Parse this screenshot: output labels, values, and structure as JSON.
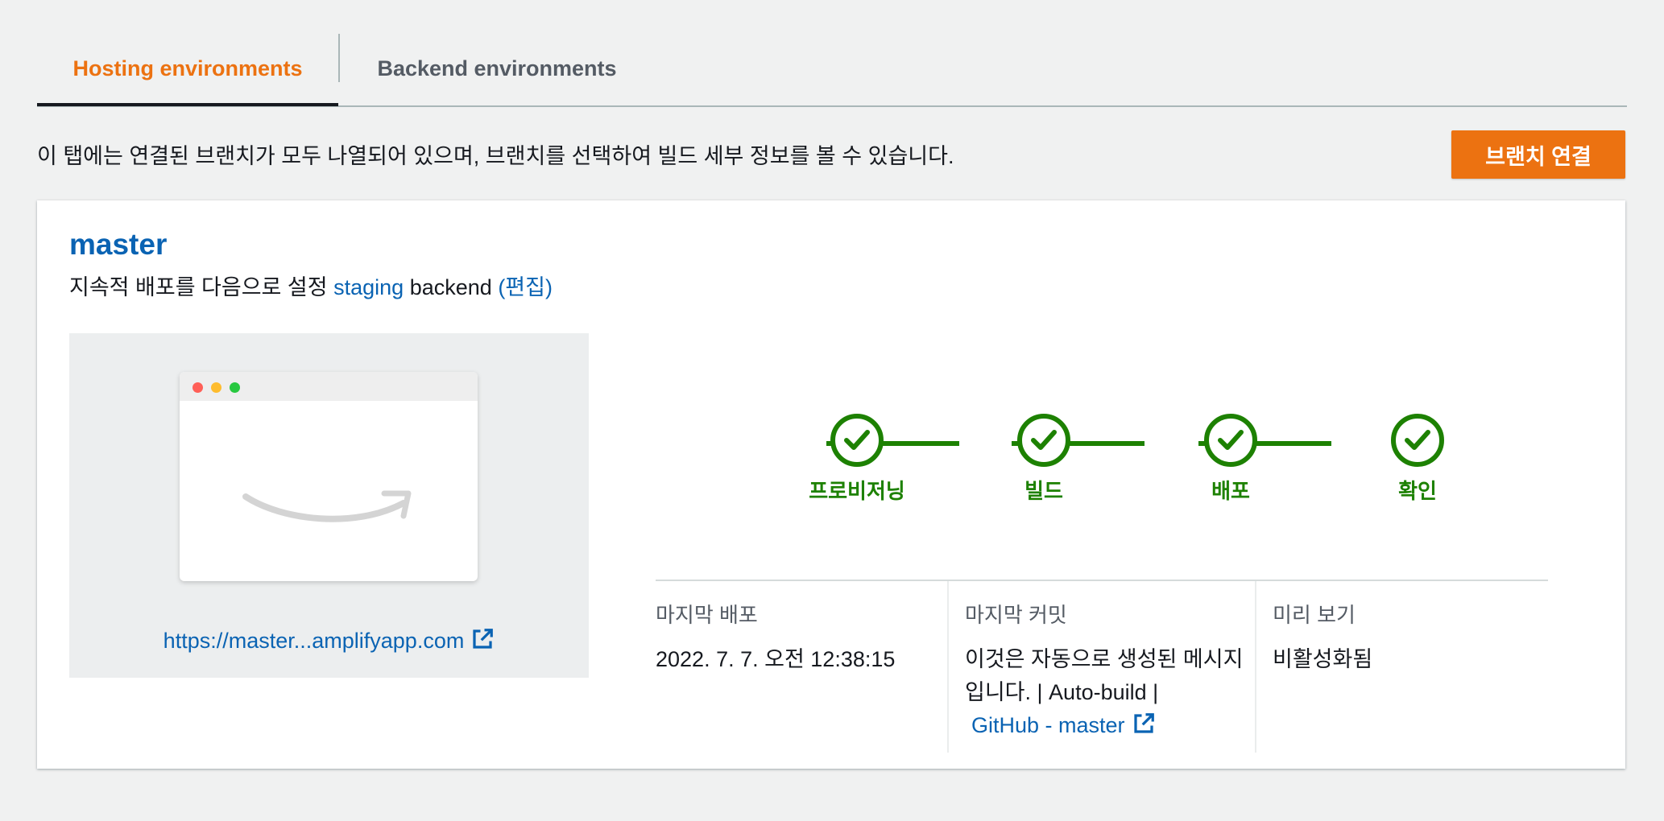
{
  "tabs": [
    {
      "label": "Hosting environments",
      "active": true
    },
    {
      "label": "Backend environments",
      "active": false
    }
  ],
  "description": "이 탭에는 연결된 브랜치가 모두 나열되어 있으며, 브랜치를 선택하여 빌드 세부 정보를 볼 수 있습니다.",
  "connect_branch_button": "브랜치 연결",
  "branch": {
    "name": "master",
    "cd_prefix": "지속적 배포를 다음으로 설정",
    "backend_env": "staging",
    "backend_word": "backend",
    "edit_link": "(편집)"
  },
  "preview": {
    "url": "https://master...amplifyapp.com",
    "url_icon": "external-link-icon"
  },
  "steps": [
    {
      "label": "프로비저닝",
      "status": "success"
    },
    {
      "label": "빌드",
      "status": "success"
    },
    {
      "label": "배포",
      "status": "success"
    },
    {
      "label": "확인",
      "status": "success"
    }
  ],
  "info": {
    "last_deploy_label": "마지막 배포",
    "last_deploy_value": "2022. 7. 7. 오전 12:38:15",
    "last_commit_label": "마지막 커밋",
    "last_commit_line1": "이것은 자동으로 생성된 메시지",
    "last_commit_line2": "입니다. | Auto-build |",
    "last_commit_link": "GitHub - master",
    "preview_label": "미리 보기",
    "preview_value": "비활성화됨"
  },
  "colors": {
    "accent": "#ec7211",
    "link": "#0a63b3",
    "success": "#1d8102"
  }
}
